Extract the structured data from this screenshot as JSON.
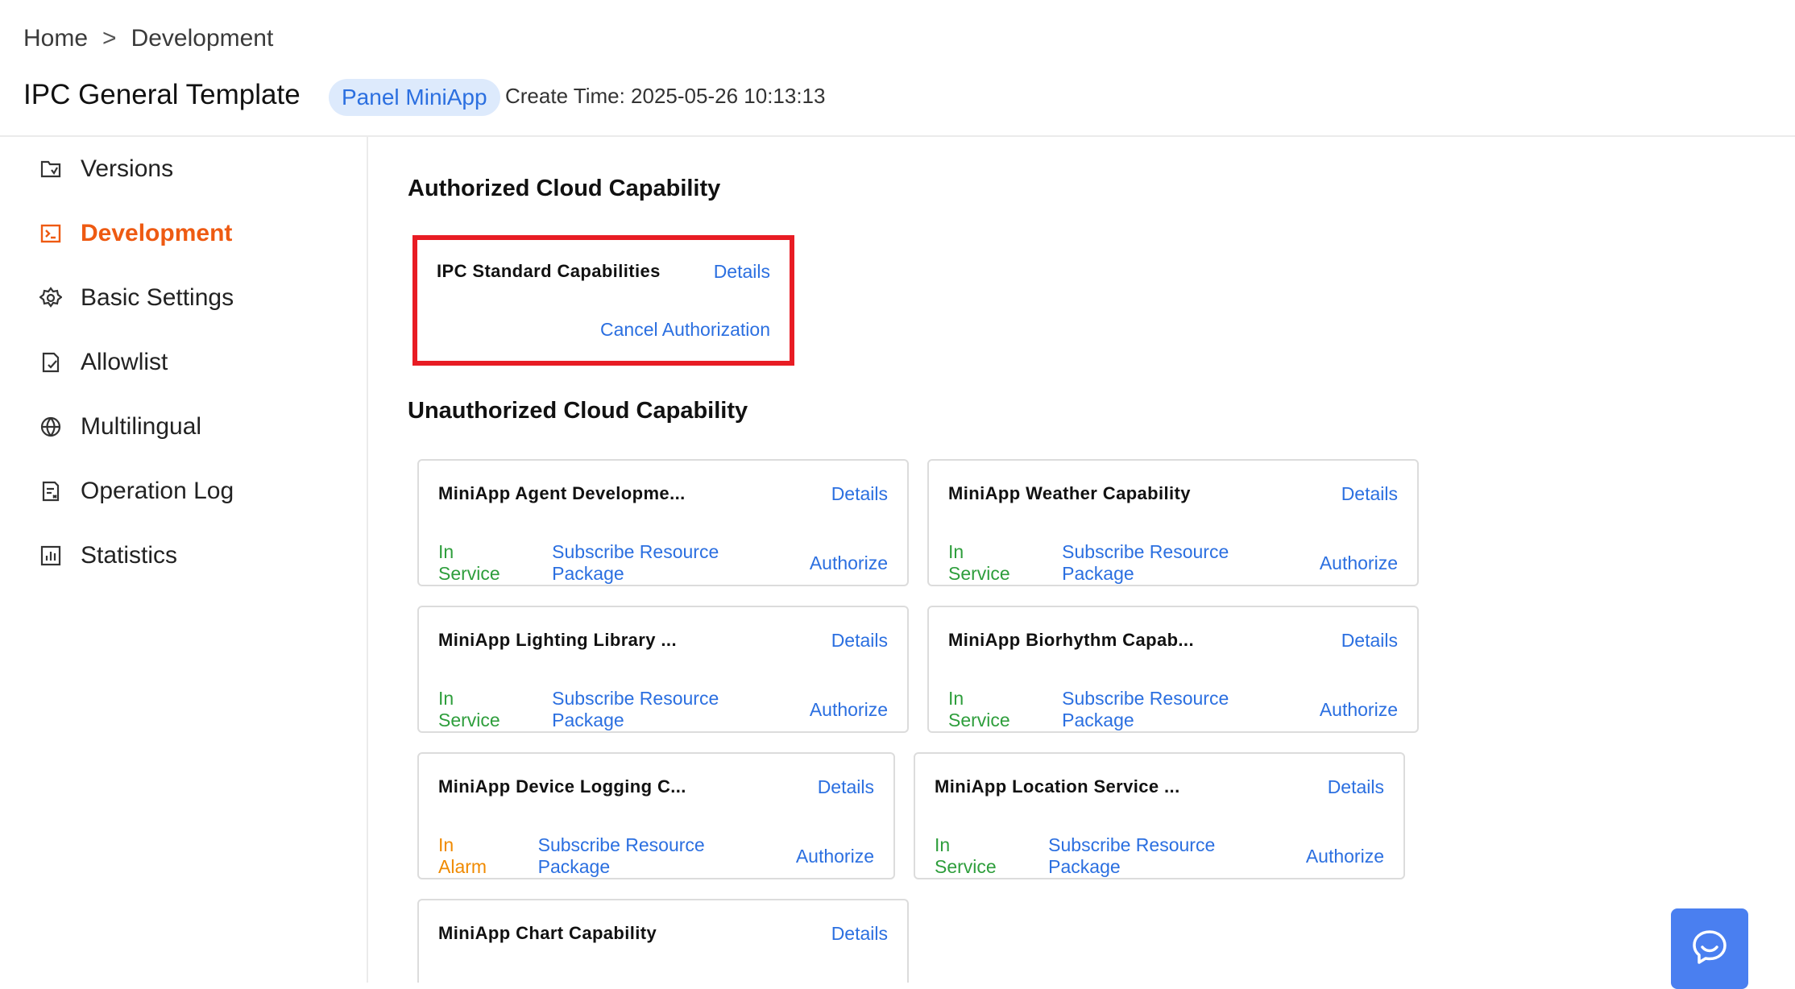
{
  "breadcrumb": {
    "home": "Home",
    "separator": ">",
    "current": "Development"
  },
  "header": {
    "title": "IPC General Template",
    "tag": "Panel MiniApp",
    "create_time": "Create Time: 2025-05-26 10:13:13"
  },
  "sidebar": {
    "items": [
      {
        "label": "Versions",
        "icon": "versions-icon"
      },
      {
        "label": "Development",
        "icon": "terminal-icon",
        "active": true
      },
      {
        "label": "Basic Settings",
        "icon": "gear-icon"
      },
      {
        "label": "Allowlist",
        "icon": "allowlist-icon"
      },
      {
        "label": "Multilingual",
        "icon": "globe-icon"
      },
      {
        "label": "Operation Log",
        "icon": "log-icon"
      },
      {
        "label": "Statistics",
        "icon": "chart-icon"
      }
    ]
  },
  "authorized": {
    "title": "Authorized Cloud Capability",
    "card": {
      "name": "IPC Standard Capabilities",
      "details": "Details",
      "cancel": "Cancel Authorization"
    }
  },
  "unauthorized": {
    "title": "Unauthorized Cloud Capability",
    "cards": [
      {
        "name": "MiniApp Agent Developme...",
        "details": "Details",
        "status": "In Service",
        "subscribe": "Subscribe Resource Package",
        "authorize": "Authorize"
      },
      {
        "name": "MiniApp Weather Capability",
        "details": "Details",
        "status": "In Service",
        "subscribe": "Subscribe Resource Package",
        "authorize": "Authorize"
      },
      {
        "name": "MiniApp Lighting Library ...",
        "details": "Details",
        "status": "In Service",
        "subscribe": "Subscribe Resource Package",
        "authorize": "Authorize"
      },
      {
        "name": "MiniApp Biorhythm Capab...",
        "details": "Details",
        "status": "In Service",
        "subscribe": "Subscribe Resource Package",
        "authorize": "Authorize"
      },
      {
        "name": "MiniApp Device Logging C...",
        "details": "Details",
        "status": "In Alarm",
        "subscribe": "Subscribe Resource Package",
        "authorize": "Authorize"
      },
      {
        "name": "MiniApp Location Service ...",
        "details": "Details",
        "status": "In Service",
        "subscribe": "Subscribe Resource Package",
        "authorize": "Authorize"
      },
      {
        "name": "MiniApp Chart Capability",
        "details": "Details"
      }
    ]
  },
  "colors": {
    "accent": "#ee5a12",
    "link": "#2b6fe0",
    "in_service": "#2e9e3c",
    "in_alarm": "#f08a00",
    "highlight": "#e81c24",
    "chat": "#4a7ff0"
  },
  "chat": {
    "icon": "chat-icon"
  }
}
